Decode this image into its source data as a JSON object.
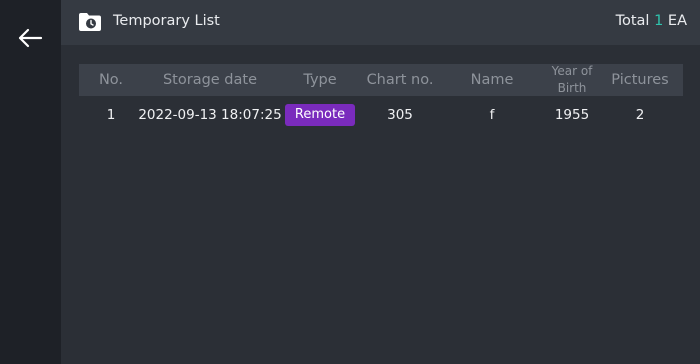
{
  "header": {
    "title": "Temporary List",
    "total_prefix": "Total",
    "total_count": "1",
    "total_suffix": "EA"
  },
  "icons": {
    "back": "arrow-left-icon",
    "folder": "folder-clock-icon"
  },
  "colors": {
    "accent_count": "#2fc3ad",
    "type_badge": "#7a2bbd"
  },
  "table": {
    "headers": {
      "no": "No.",
      "storage_date": "Storage date",
      "type": "Type",
      "chart_no": "Chart no.",
      "name": "Name",
      "year_of_birth_line1": "Year of",
      "year_of_birth_line2": "Birth",
      "pictures": "Pictures"
    },
    "rows": [
      {
        "no": "1",
        "storage_date": "2022-09-13 18:07:25",
        "type": "Remote",
        "chart_no": "305",
        "name": "f",
        "year_of_birth": "1955",
        "pictures": "2"
      }
    ]
  }
}
